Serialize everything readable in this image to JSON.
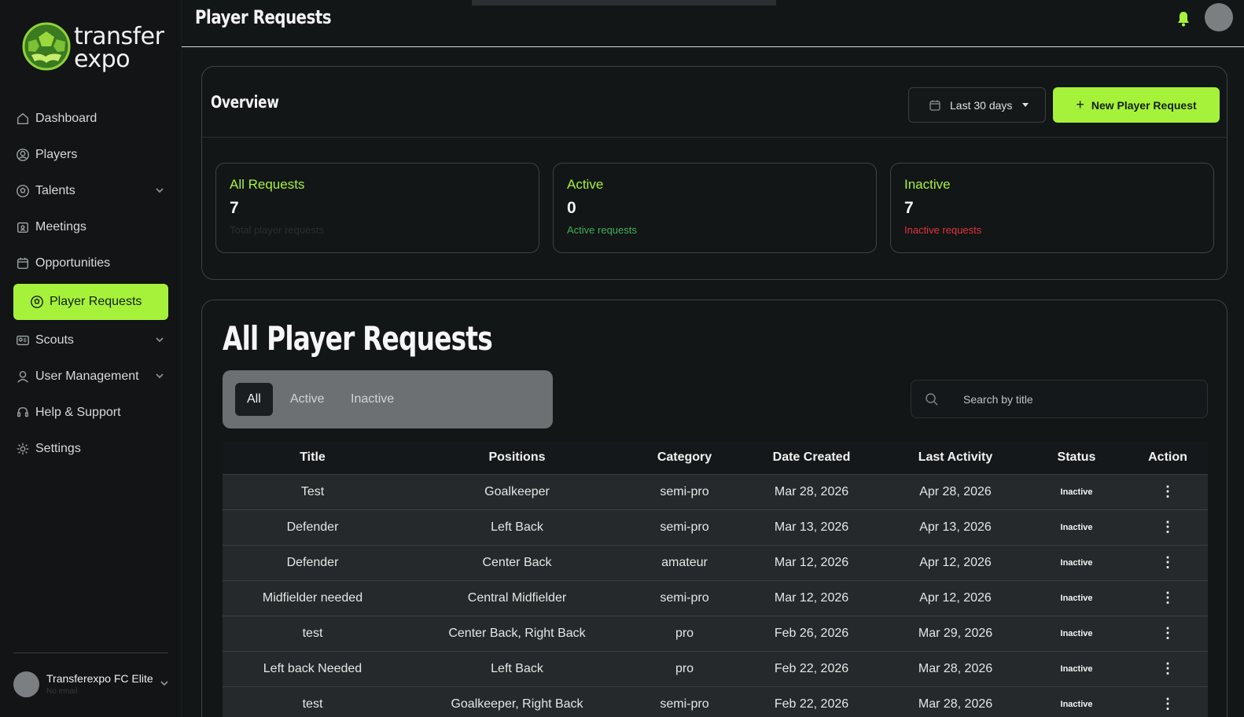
{
  "brand": {
    "name_line1": "transfer",
    "name_line2": "expo"
  },
  "sidebar": {
    "items": [
      {
        "label": "Dashboard",
        "icon": "home-icon"
      },
      {
        "label": "Players",
        "icon": "user-circle-icon"
      },
      {
        "label": "Talents",
        "icon": "soccer-ball-icon",
        "has_submenu": true
      },
      {
        "label": "Meetings",
        "icon": "calendar-user-icon"
      },
      {
        "label": "Opportunities",
        "icon": "calendar-icon"
      },
      {
        "label": "Player Requests",
        "icon": "soccer-ball-icon",
        "active": true
      },
      {
        "label": "Scouts",
        "icon": "id-card-icon",
        "has_submenu": true
      },
      {
        "label": "User Management",
        "icon": "user-icon",
        "has_submenu": true
      },
      {
        "label": "Help & Support",
        "icon": "headset-icon"
      },
      {
        "label": "Settings",
        "icon": "gear-icon"
      }
    ],
    "user": {
      "name": "Transferexpo FC Elite",
      "email": "No email"
    }
  },
  "header": {
    "title": "Player Requests"
  },
  "overview": {
    "title": "Overview",
    "date_range": "Last 30 days",
    "new_button": "New Player Request",
    "stats": [
      {
        "label": "All Requests",
        "value": "7",
        "sub": "Total player requests",
        "sub_color": "#2a2e30"
      },
      {
        "label": "Active",
        "value": "0",
        "sub": "Active requests",
        "sub_color": "#3fae5a"
      },
      {
        "label": "Inactive",
        "value": "7",
        "sub": "Inactive requests",
        "sub_color": "#e0323b"
      }
    ]
  },
  "requests": {
    "title": "All Player Requests",
    "tabs": [
      "All",
      "Active",
      "Inactive"
    ],
    "selected_tab": "All",
    "search_placeholder": "Search by title",
    "columns": [
      "Title",
      "Positions",
      "Category",
      "Date Created",
      "Last Activity",
      "Status",
      "Action"
    ],
    "rows": [
      [
        "Test",
        "Goalkeeper",
        "semi-pro",
        "Mar 28, 2026",
        "Apr 28, 2026",
        "Inactive",
        "⋮"
      ],
      [
        "Defender",
        "Left Back",
        "semi-pro",
        "Mar 13, 2026",
        "Apr 13, 2026",
        "Inactive",
        "⋮"
      ],
      [
        "Defender",
        "Center Back",
        "amateur",
        "Mar 12, 2026",
        "Apr 12, 2026",
        "Inactive",
        "⋮"
      ],
      [
        "Midfielder needed",
        "Central Midfielder",
        "semi-pro",
        "Mar 12, 2026",
        "Apr 12, 2026",
        "Inactive",
        "⋮"
      ],
      [
        "test",
        "Center Back, Right Back",
        "pro",
        "Feb 26, 2026",
        "Mar 29, 2026",
        "Inactive",
        "⋮"
      ],
      [
        "Left back Needed",
        "Left Back",
        "pro",
        "Feb 22, 2026",
        "Mar 28, 2026",
        "Inactive",
        "⋮"
      ],
      [
        "test",
        "Goalkeeper, Right Back",
        "semi-pro",
        "Feb 22, 2026",
        "Mar 28, 2026",
        "Inactive",
        "⋮"
      ]
    ]
  },
  "colors": {
    "accent": "#a6f23b",
    "background": "#131617",
    "active_green": "#3fae5a",
    "inactive_red": "#e0323b"
  }
}
